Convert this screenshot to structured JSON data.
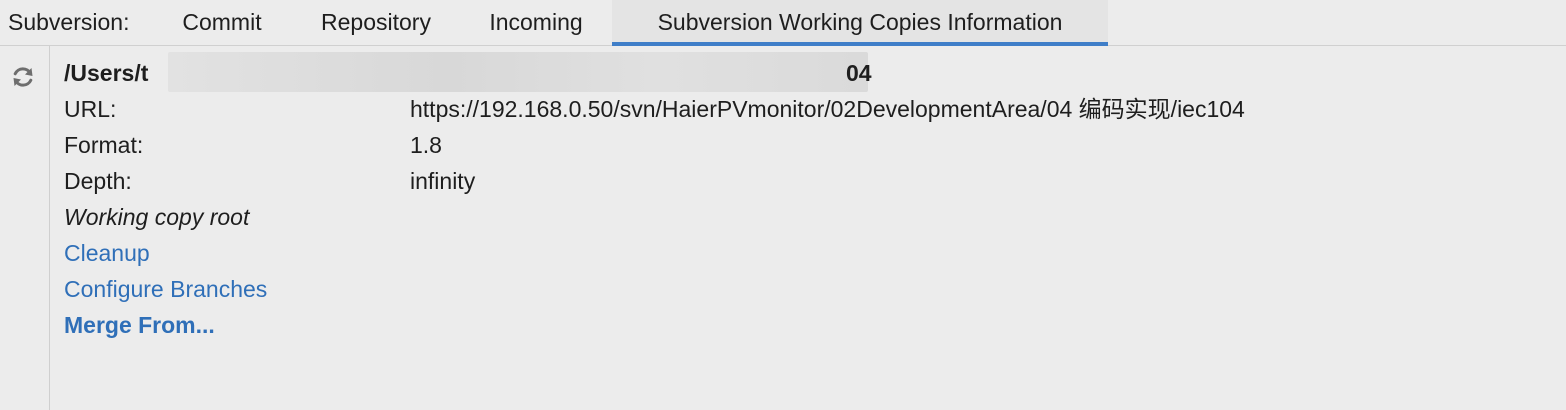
{
  "tabbar": {
    "title": "Subversion:",
    "tabs": [
      {
        "label": "Commit",
        "selected": false
      },
      {
        "label": "Repository",
        "selected": false
      },
      {
        "label": "Incoming",
        "selected": false
      },
      {
        "label": "Subversion Working Copies Information",
        "selected": true
      }
    ]
  },
  "toolbar": {
    "refresh_icon": "refresh-icon"
  },
  "info": {
    "path_prefix": "/Users/t",
    "path_suffix": "04",
    "url_label": "URL:",
    "url_value": "https://192.168.0.50/svn/HaierPVmonitor/02DevelopmentArea/04 编码实现/iec104",
    "format_label": "Format:",
    "format_value": "1.8",
    "depth_label": "Depth:",
    "depth_value": "infinity",
    "working_copy_root": "Working copy root"
  },
  "actions": {
    "cleanup": "Cleanup",
    "configure_branches": "Configure Branches",
    "merge_from": "Merge From..."
  },
  "colors": {
    "accent": "#3f7ec8",
    "link": "#2f6fb8",
    "background": "#ececec"
  }
}
